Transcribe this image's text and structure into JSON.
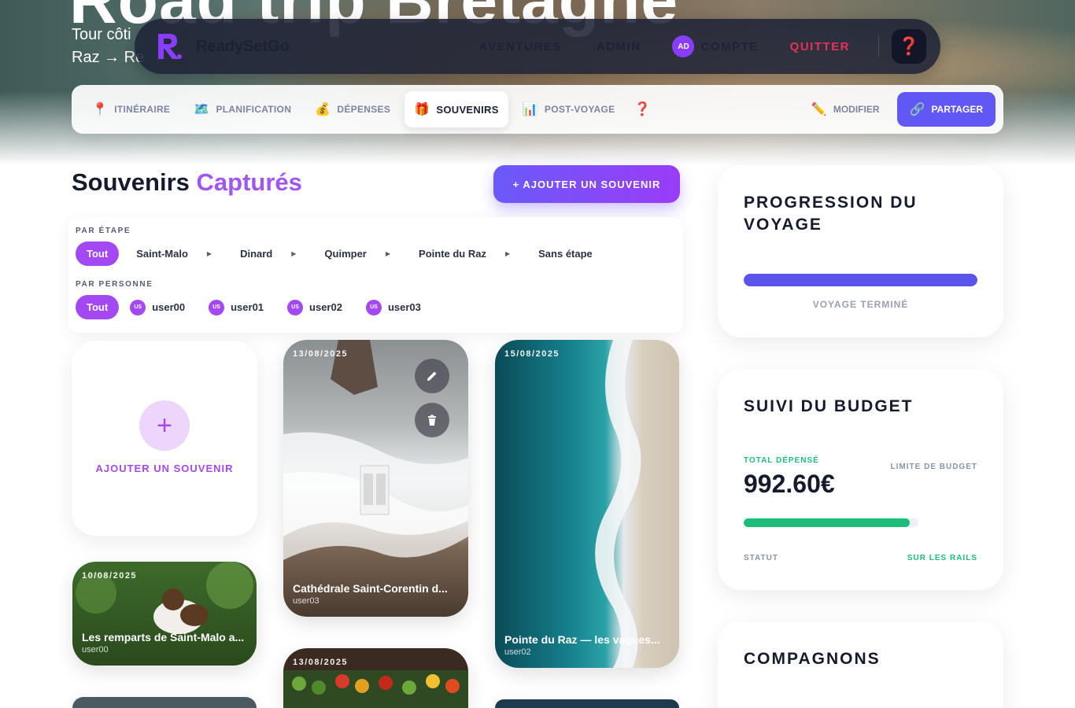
{
  "hero": {
    "title": "Road trip Bretagne",
    "subtitle_line1": "Tour côti",
    "subtitle_line2": "Raz → Re"
  },
  "topnav": {
    "brand": "ReadySetGo",
    "links": [
      "AVENTURES",
      "ADMIN"
    ],
    "account_initials": "AD",
    "account_label": "COMPTE",
    "quit_label": "QUITTER",
    "help_icon": "❓"
  },
  "tabs": {
    "items": [
      {
        "icon": "📍",
        "label": "ITINÉRAIRE"
      },
      {
        "icon": "🗺️",
        "label": "PLANIFICATION"
      },
      {
        "icon": "💰",
        "label": "DÉPENSES"
      },
      {
        "icon": "🎁",
        "label": "SOUVENIRS"
      },
      {
        "icon": "📊",
        "label": "POST-VOYAGE"
      }
    ],
    "help_icon": "❓",
    "edit_icon": "✏️",
    "edit_label": "MODIFIER",
    "share_icon": "🔗",
    "share_label": "PARTAGER"
  },
  "souvenirs": {
    "title_main": "Souvenirs",
    "title_accent": "Capturés",
    "add_button": "+ AJOUTER UN SOUVENIR"
  },
  "filters": {
    "stage_label": "PAR ÉTAPE",
    "stages": [
      "Tout",
      "Saint-Malo",
      "Dinard",
      "Quimper",
      "Pointe du Raz",
      "Sans étape"
    ],
    "person_label": "PAR PERSONNE",
    "person_all": "Tout",
    "people": [
      {
        "badge": "US",
        "name": "user00"
      },
      {
        "badge": "US",
        "name": "user01"
      },
      {
        "badge": "US",
        "name": "user02"
      },
      {
        "badge": "US",
        "name": "user03"
      }
    ]
  },
  "cards": {
    "add_label": "AJOUTER UN SOUVENIR",
    "items": [
      {
        "date": "13/08/2025",
        "title": "Cathédrale Saint-Corentin d...",
        "user": "user03"
      },
      {
        "date": "15/08/2025",
        "title": "Pointe du Raz — les vagues...",
        "user": "user02"
      },
      {
        "date": "10/08/2025",
        "title": "Les remparts de Saint-Malo a...",
        "user": "user00"
      },
      {
        "date": "13/08/2025",
        "title": "",
        "user": ""
      }
    ]
  },
  "progress_panel": {
    "title": "PROGRESSION DU VOYAGE",
    "value_pct": 100,
    "status": "VOYAGE TERMINÉ"
  },
  "budget_panel": {
    "title": "SUIVI DU BUDGET",
    "spent_label": "TOTAL DÉPENSÉ",
    "limit_label": "LIMITE DE BUDGET",
    "spent_value": "992.60€",
    "bar_pct": 95,
    "status_label": "STATUT",
    "status_value": "SUR LES RAILS"
  },
  "companions_panel": {
    "title": "COMPAGNONS"
  },
  "colors": {
    "accent": "#a348f3",
    "primary": "#6157f5",
    "danger": "#e8315a",
    "success": "#1cbd7a"
  }
}
